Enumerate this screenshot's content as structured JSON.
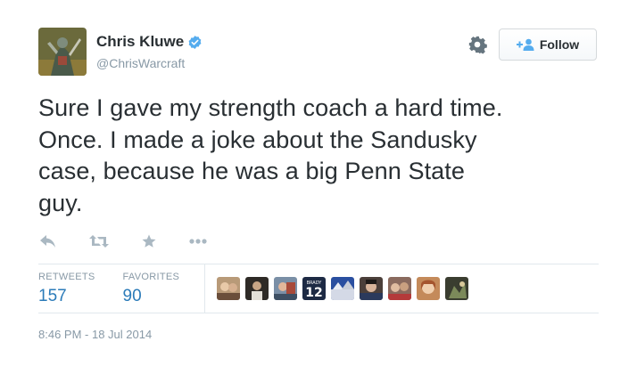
{
  "author": {
    "name": "Chris Kluwe",
    "handle": "@ChrisWarcraft",
    "verified": true
  },
  "header": {
    "follow_label": "Follow",
    "icons": [
      "gear-icon",
      "follow-person-icon"
    ]
  },
  "tweet": {
    "lines": [
      "Sure I gave my strength coach a hard time.",
      "Once. I made a joke about the Sandusky",
      "case, because he was a big Penn State",
      "guy."
    ],
    "timestamp": "8:46 PM - 18 Jul 2014"
  },
  "actions": [
    "reply-icon",
    "retweet-icon",
    "favorite-icon",
    "more-icon"
  ],
  "stats": {
    "retweets_label": "RETWEETS",
    "retweets_count": "157",
    "favorites_label": "FAVORITES",
    "favorites_count": "90"
  },
  "favoriters": {
    "count": 9,
    "jersey_number": "12",
    "jersey_name": "BRADY"
  },
  "colors": {
    "text": "#292f33",
    "muted": "#8899a6",
    "link_blue": "#2b7bb9",
    "verified_blue": "#55acee",
    "divider": "#e1e8ed"
  }
}
